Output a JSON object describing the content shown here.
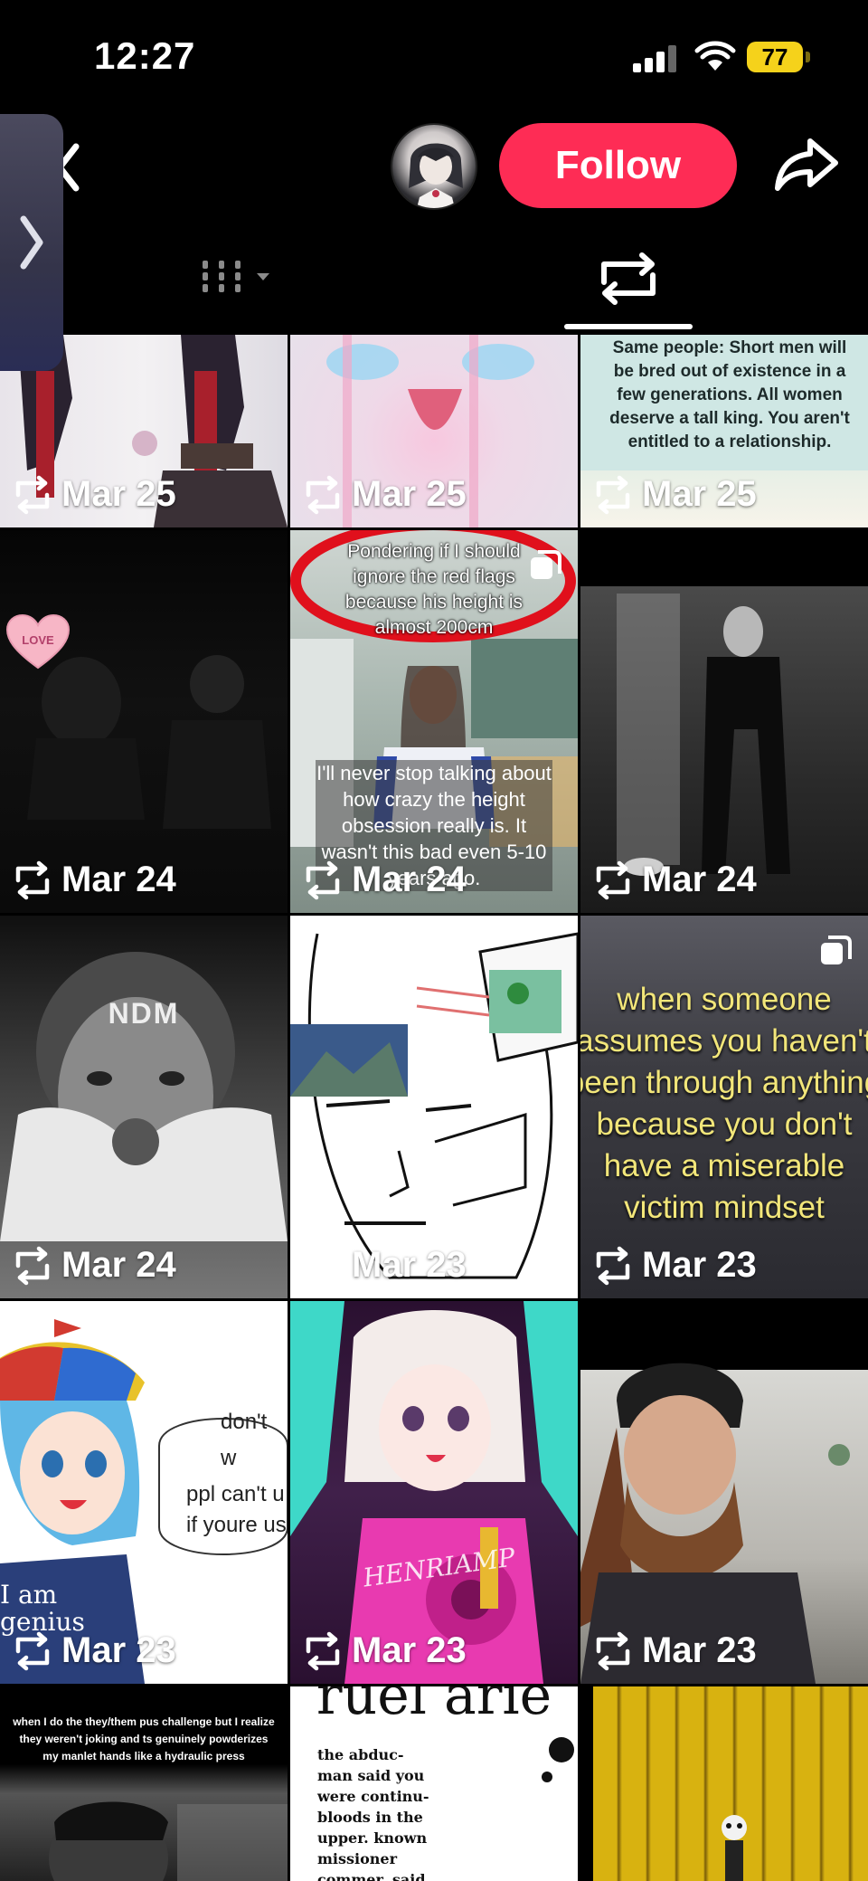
{
  "status_bar": {
    "time": "12:27",
    "battery": "77"
  },
  "header": {
    "follow_label": "Follow"
  },
  "tiles": [
    {
      "date": "Mar 25"
    },
    {
      "date": "Mar 25"
    },
    {
      "date": "Mar 25",
      "caption": "Same people: Short men will be bred out of existence in a few generations. All women deserve a tall king. You aren't entitled to a relationship."
    },
    {
      "date": "Mar 24",
      "sticker": "LOVE"
    },
    {
      "date": "Mar 24",
      "caption_top": "Pondering if I should ignore the red flags because his height is almost 200cm",
      "caption_bottom": "I'll never stop talking about how crazy the height obsession really is. It wasn't this bad even 5-10 years ago."
    },
    {
      "date": "Mar 24"
    },
    {
      "date": "Mar 24",
      "cap_text": "NDM"
    },
    {
      "date": "Mar 23"
    },
    {
      "date": "Mar 23",
      "caption": "when someone assumes you haven't been through anything because you don't have a miserable victim mindset"
    },
    {
      "date": "Mar 23",
      "bubble": [
        "don't w",
        "ppl can't u",
        "if youre us"
      ],
      "shirt": "I am genius"
    },
    {
      "date": "Mar 23",
      "signature": "HENRIAMP"
    },
    {
      "date": "Mar 23"
    },
    {
      "caption": "when I do the they/them pus challenge but I realize they weren't joking and ts genuinely powderizes my manlet hands like a hydraulic press"
    },
    {
      "caption_big": "ruel arie",
      "caption_small": "the abduc- man said you were continu- bloods in the upper. known missioner commer, said the public the inquiry"
    },
    {}
  ]
}
